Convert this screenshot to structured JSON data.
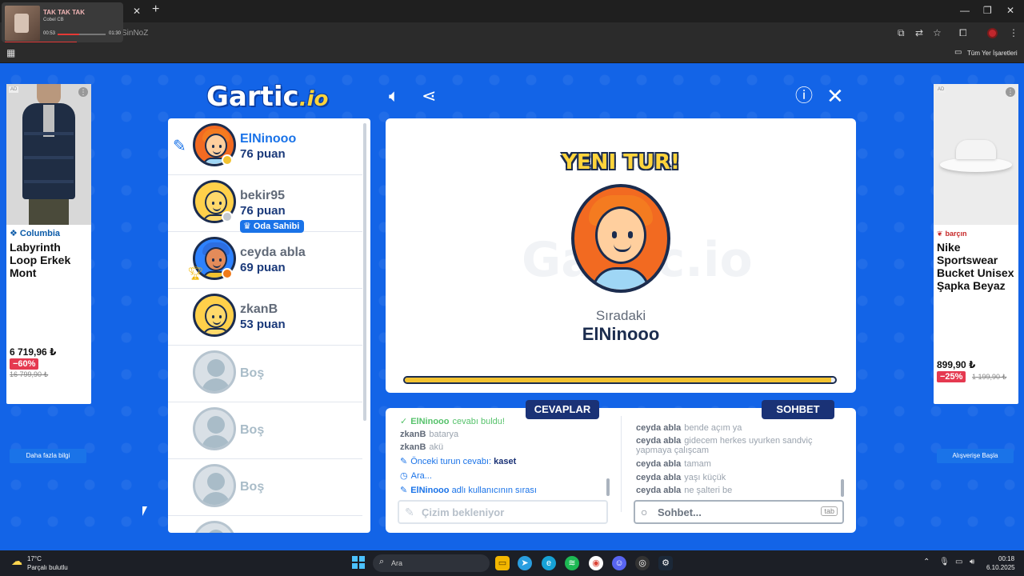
{
  "browser": {
    "media": {
      "title": "TAK TAK TAK",
      "artist": "Cobel CB",
      "time_current": "00:53",
      "time_total": "01:30",
      "progress": 0.45
    },
    "url_fragment": "SinNoZ",
    "bookmarks_label": "Tüm Yer İşaretleri"
  },
  "header": {
    "logo_main": "Gartic",
    "logo_suffix": ".io"
  },
  "players": [
    {
      "name": "ElNinooo",
      "score": "76 puan",
      "active": true,
      "avatar": "orange"
    },
    {
      "name": "bekir95",
      "score": "76 puan",
      "badge": "Oda Sahibi",
      "avatar": "yellow"
    },
    {
      "name": "ceyda abla",
      "score": "69 puan",
      "avatar": "blue",
      "rank": "2"
    },
    {
      "name": "zkanB",
      "score": "53 puan",
      "avatar": "yellow"
    },
    {
      "name": "Boş"
    },
    {
      "name": "Boş"
    },
    {
      "name": "Boş"
    }
  ],
  "board": {
    "headline": "YENI TUR!",
    "next_label": "Sıradaki",
    "next_player": "ElNinooo",
    "timer_fraction": 0.99,
    "watermark": "Gartic.io"
  },
  "answers": {
    "tab_label": "CEVAPLAR",
    "messages": [
      {
        "who": "ElNinooo",
        "text": "cevabı buldu!"
      },
      {
        "who": "zkanB",
        "text": "batarya"
      },
      {
        "who": "zkanB",
        "text": "akü"
      },
      {
        "pre": "Önceki turun cevabı:",
        "bold": "kaset"
      },
      {
        "text": "Ara..."
      },
      {
        "bold": "ElNinooo",
        "text": "adlı kullanıcının sırası"
      }
    ],
    "input_placeholder": "Çizim bekleniyor"
  },
  "chat": {
    "tab_label": "SOHBET",
    "messages": [
      {
        "who": "ceyda abla",
        "text": "bende açım ya"
      },
      {
        "who": "ceyda abla",
        "text": "gidecem herkes uyurken sandviç yapmaya çalışcam"
      },
      {
        "who": "ceyda abla",
        "text": "tamam"
      },
      {
        "who": "ceyda abla",
        "text": "yaşı küçük"
      },
      {
        "who": "ceyda abla",
        "text": "ne şalteri be"
      }
    ],
    "input_placeholder": "Sohbet...",
    "tab_hint": "tab"
  },
  "ads": {
    "left": {
      "badge": "AD",
      "brand": "Columbia",
      "title": "Labyrinth Loop Erkek Mont",
      "price": "6 719,96 ₺",
      "discount": "−60%",
      "old_price": "16 799,90 ₺",
      "cta": "Daha fazla bilgi"
    },
    "right": {
      "badge": "AD",
      "brand": "barçın",
      "title": "Nike Sportswear Bucket Unisex Şapka Beyaz",
      "price": "899,90 ₺",
      "discount": "−25%",
      "old_price": "1 199,90 ₺",
      "cta": "Alışverişe Başla"
    }
  },
  "taskbar": {
    "temp": "17°C",
    "weather": "Parçalı bulutlu",
    "search": "Ara",
    "time": "00:18",
    "date": "6.10.2025"
  }
}
